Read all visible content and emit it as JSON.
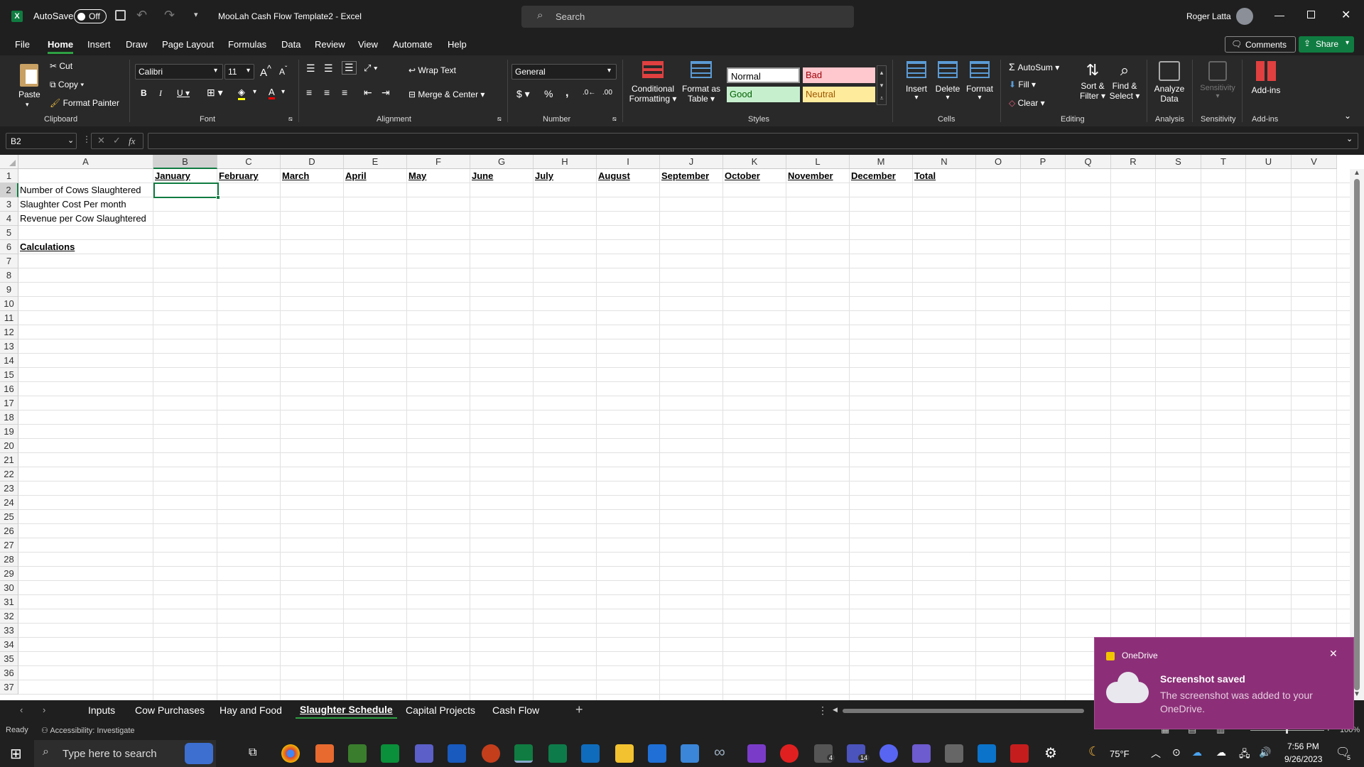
{
  "titlebar": {
    "autosave_label": "AutoSave",
    "autosave_state": "Off",
    "doc_title": "MooLah Cash Flow Template2  -  Excel",
    "search_placeholder": "Search",
    "user_name": "Roger Latta"
  },
  "menu": {
    "items": [
      "File",
      "Home",
      "Insert",
      "Draw",
      "Page Layout",
      "Formulas",
      "Data",
      "Review",
      "View",
      "Automate",
      "Help"
    ],
    "comments": "Comments",
    "share": "Share"
  },
  "ribbon": {
    "clipboard": {
      "paste": "Paste",
      "cut": "Cut",
      "copy": "Copy",
      "format_painter": "Format Painter",
      "group": "Clipboard"
    },
    "font": {
      "name": "Calibri",
      "size": "11",
      "group": "Font"
    },
    "alignment": {
      "wrap": "Wrap Text",
      "merge": "Merge & Center",
      "group": "Alignment"
    },
    "number": {
      "format": "General",
      "group": "Number"
    },
    "styles": {
      "conditional": "Conditional",
      "conditional2": "Formatting",
      "format_table": "Format as",
      "format_table2": "Table",
      "normal": "Normal",
      "bad": "Bad",
      "good": "Good",
      "neutral": "Neutral",
      "group": "Styles"
    },
    "cells": {
      "insert": "Insert",
      "delete": "Delete",
      "format": "Format",
      "group": "Cells"
    },
    "editing": {
      "autosum": "AutoSum",
      "fill": "Fill",
      "clear": "Clear",
      "sort": "Sort &",
      "sort2": "Filter",
      "find": "Find &",
      "find2": "Select",
      "group": "Editing"
    },
    "analysis": {
      "analyze": "Analyze",
      "analyze2": "Data",
      "group": "Analysis"
    },
    "sensitivity": {
      "label": "Sensitivity",
      "group": "Sensitivity"
    },
    "addins": {
      "label": "Add-ins",
      "group": "Add-ins"
    }
  },
  "formula_bar": {
    "name_box": "B2",
    "fx": "fx",
    "value": ""
  },
  "sheet": {
    "columns": [
      "A",
      "B",
      "C",
      "D",
      "E",
      "F",
      "G",
      "H",
      "I",
      "J",
      "K",
      "L",
      "M",
      "N",
      "O",
      "P",
      "Q",
      "R",
      "S",
      "T",
      "U",
      "V"
    ],
    "rows": [
      "1",
      "2",
      "3",
      "4",
      "5",
      "6",
      "7",
      "8",
      "9",
      "10",
      "11",
      "12",
      "13",
      "14",
      "15",
      "16",
      "17",
      "18",
      "19",
      "20",
      "21",
      "22",
      "23",
      "24",
      "25",
      "26",
      "27",
      "28",
      "29",
      "30",
      "31",
      "32",
      "33",
      "34",
      "35",
      "36",
      "37"
    ],
    "months": [
      "January",
      "February",
      "March",
      "April",
      "May",
      "June",
      "July",
      "August",
      "September",
      "October",
      "November",
      "December",
      "Total"
    ],
    "a2": "Number of Cows Slaughtered",
    "a3": "Slaughter Cost Per month",
    "a4": "Revenue per Cow Slaughtered",
    "a6": "Calculations"
  },
  "tabs": [
    "Inputs",
    "Cow Purchases",
    "Hay and Food",
    "Slaughter Schedule",
    "Capital Projects",
    "Cash Flow"
  ],
  "status": {
    "ready": "Ready",
    "accessibility": "Accessibility: Investigate",
    "zoom": "100%"
  },
  "toast": {
    "app": "OneDrive",
    "title": "Screenshot saved",
    "body": "The screenshot was added to your OneDrive."
  },
  "taskbar": {
    "search_placeholder": "Type here to search",
    "weather": "75°F",
    "time": "7:56 PM",
    "date": "9/26/2023",
    "notif_count": "5",
    "badge_mail": "4",
    "badge_teams": "14"
  }
}
